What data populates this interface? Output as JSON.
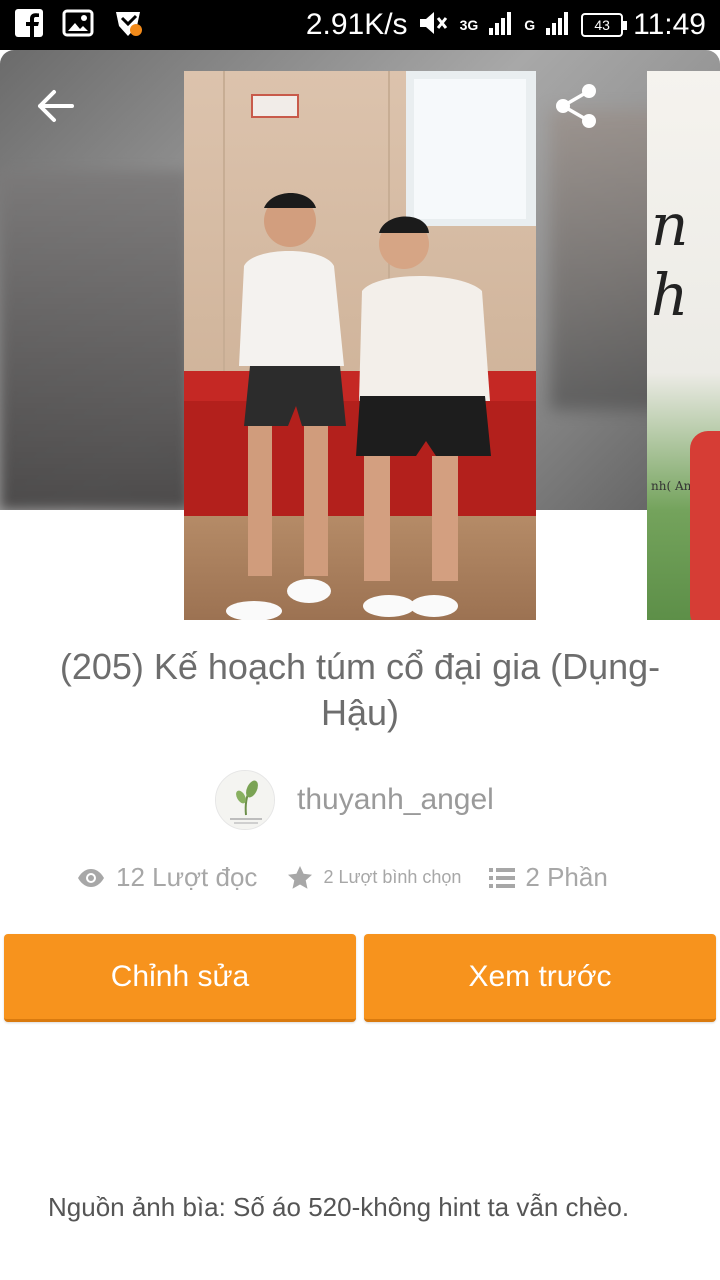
{
  "status_bar": {
    "speed": "2.91K/s",
    "network_3g": "3G",
    "network_g": "G",
    "battery": "43",
    "time": "11:49"
  },
  "header": {
    "icons": [
      "arrow-left-icon",
      "share-icon",
      "more-vert-icon"
    ]
  },
  "story": {
    "title": "(205) Kế hoạch túm cổ đại gia (Dụng-Hậu)",
    "author": "thuyanh_angel",
    "stats": {
      "reads": "12 Lượt đọc",
      "votes": "2 Lượt bình chọn",
      "parts": "2 Phần"
    }
  },
  "side_cover": {
    "script_text": "n\nh",
    "small_text": "nh( Angel )"
  },
  "actions": {
    "edit_label": "Chỉnh sửa",
    "preview_label": "Xem trước"
  },
  "description": {
    "credit": "Nguồn ảnh bìa: Số áo 520-không hint ta vẫn chèo."
  },
  "colors": {
    "accent": "#F7931D",
    "text_muted": "#A7A7A7",
    "title": "#6D6D6D"
  }
}
